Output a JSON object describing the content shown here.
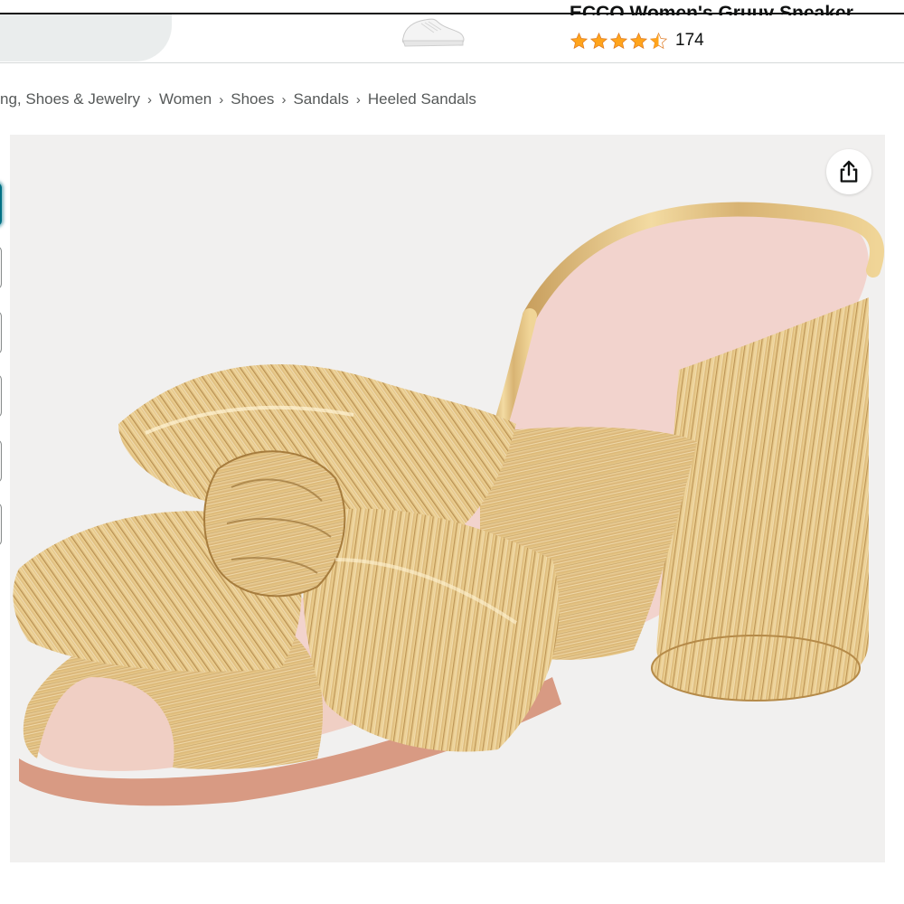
{
  "sponsored": {
    "product_title": "ECCO Women's Gruuv Sneaker",
    "rating_stars": 4.5,
    "rating_count": "174",
    "thumbnail_icon": "white-sneaker-icon"
  },
  "breadcrumb": {
    "items": [
      "ng, Shoes & Jewelry",
      "Women",
      "Shoes",
      "Sandals",
      "Heeled Sandals"
    ],
    "separator": "›"
  },
  "gallery": {
    "thumbnail_count": 6,
    "active_thumbnail": 0,
    "main_image_icon": "gold-pleated-bow-mule-sandal",
    "share_icon": "share-icon"
  },
  "colors": {
    "star": "#ffa41c",
    "active_outline": "#007185",
    "link_grey": "#565959",
    "image_bg": "#f1f0ef"
  }
}
